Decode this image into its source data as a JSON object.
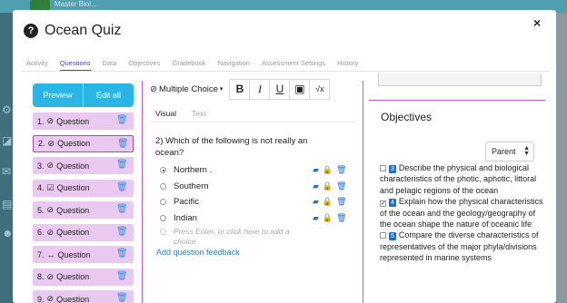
{
  "background": {
    "app_name": "Master Biol..."
  },
  "modal": {
    "title": "Ocean Quiz",
    "close_label": "×",
    "help_label": "?"
  },
  "tabs": [
    "Activity",
    "Questions",
    "Data",
    "Objectives",
    "Gradebook",
    "Navigation",
    "Assessment Settings",
    "History"
  ],
  "left": {
    "preview_label": "Preview",
    "edit_all_label": "Edit all",
    "questions": [
      {
        "num": "1.",
        "type_icon": "⊘",
        "label": "Question"
      },
      {
        "num": "2.",
        "type_icon": "⊘",
        "label": "Question"
      },
      {
        "num": "3.",
        "type_icon": "⊘",
        "label": "Question"
      },
      {
        "num": "4.",
        "type_icon": "☑",
        "label": "Question"
      },
      {
        "num": "5.",
        "type_icon": "⊘",
        "label": "Question"
      },
      {
        "num": "6.",
        "type_icon": "⊘",
        "label": "Question"
      },
      {
        "num": "7.",
        "type_icon": "↔",
        "label": "Question"
      },
      {
        "num": "8.",
        "type_icon": "⊘",
        "label": "Question"
      },
      {
        "num": "9.",
        "type_icon": "⊘",
        "label": "Question"
      }
    ]
  },
  "editor": {
    "question_type": "Multiple Choice",
    "format": {
      "bold": "B",
      "italic": "I",
      "underline": "U",
      "image": "▣",
      "formula": "√x"
    },
    "visual_tab": "Visual",
    "text_tab": "Text",
    "question_number": "2)",
    "question_text": "Which of the following is not really an ocean?",
    "answers": [
      "Northern .",
      "Southern",
      "Pacific",
      "Indian"
    ],
    "new_answer_placeholder": "Press Enter, or click here to add a choice",
    "add_feedback": "Add question feedback"
  },
  "objectives": {
    "title": "Objectives",
    "parent_select": "Parent",
    "items": [
      {
        "badge": "3",
        "checked": false,
        "text": "Describe the physical and biological characteristics of the photic, aphotic, littoral and pelagic regions of the ocean"
      },
      {
        "badge": "4",
        "checked": true,
        "text": "Explain how the physical characteristics of the ocean and the geology/geography of the ocean shape the nature of oceanic life"
      },
      {
        "badge": "5",
        "checked": false,
        "text": "Compare the diverse characteristics of representatives of the major phyla/divisions represented in marine systems"
      }
    ]
  },
  "colors": {
    "accent_purple": "#5b3fb5",
    "divider_magenta": "#c45bc9",
    "question_bg": "#e9c9ef",
    "button_blue": "#29b6e6",
    "link_blue": "#2f7fd0"
  }
}
